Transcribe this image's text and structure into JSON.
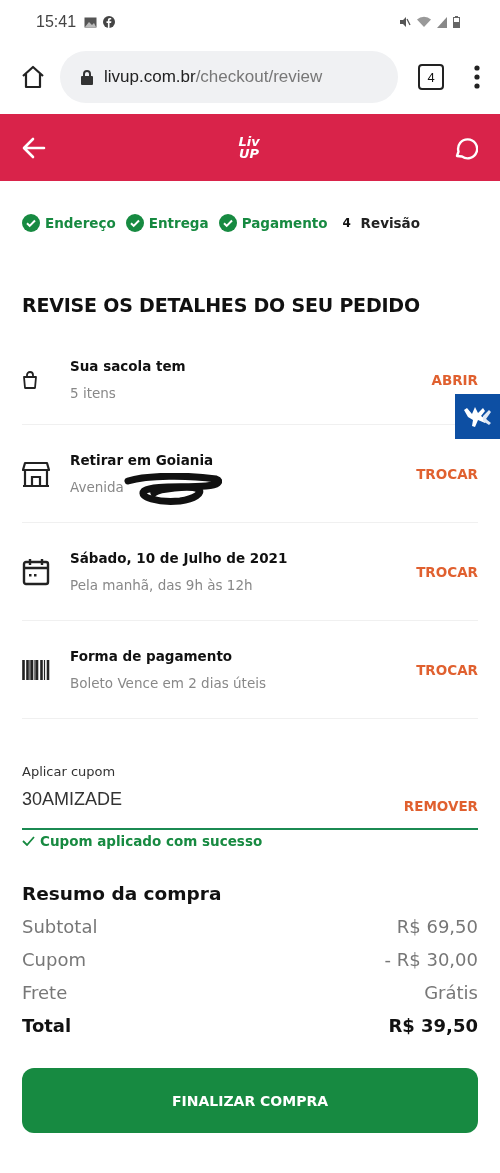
{
  "status_bar": {
    "time": "15:41"
  },
  "browser": {
    "url_host": "livup.com.br",
    "url_path": "/checkout/review",
    "tab_count": "4"
  },
  "header": {
    "logo": [
      "Liv",
      "UP"
    ]
  },
  "steps": [
    {
      "label": "Endereço",
      "done": true
    },
    {
      "label": "Entrega",
      "done": true
    },
    {
      "label": "Pagamento",
      "done": true
    },
    {
      "number": "4",
      "label": "Revisão",
      "done": false
    }
  ],
  "title": "REVISE OS DETALHES DO SEU PEDIDO",
  "details": [
    {
      "kind": "bag",
      "title": "Sua sacola tem",
      "subtitle": "5 itens",
      "action": "ABRIR",
      "redacted": false
    },
    {
      "kind": "store",
      "title": "Retirar em Goiania",
      "subtitle": "Avenida",
      "action": "TROCAR",
      "redacted": true
    },
    {
      "kind": "calendar",
      "title": "Sábado, 10 de Julho de 2021",
      "subtitle": "Pela manhã, das 9h às 12h",
      "action": "TROCAR",
      "redacted": false
    },
    {
      "kind": "barcode",
      "title": "Forma de pagamento",
      "subtitle": "Boleto  Vence em 2 dias úteis",
      "action": "TROCAR",
      "redacted": false
    }
  ],
  "coupon": {
    "label": "Aplicar cupom",
    "value": "30AMIZADE",
    "action": "REMOVER",
    "message": "Cupom aplicado com sucesso"
  },
  "summary": {
    "title": "Resumo da compra",
    "rows": [
      {
        "label": "Subtotal",
        "value": "R$ 69,50",
        "kind": "line"
      },
      {
        "label": "Cupom",
        "value": "- R$ 30,00",
        "kind": "line"
      },
      {
        "label": "Frete",
        "value": "Grátis",
        "kind": "line"
      },
      {
        "label": "Total",
        "value": "R$ 39,50",
        "kind": "total"
      }
    ]
  },
  "button": "FINALIZAR COMPRA"
}
